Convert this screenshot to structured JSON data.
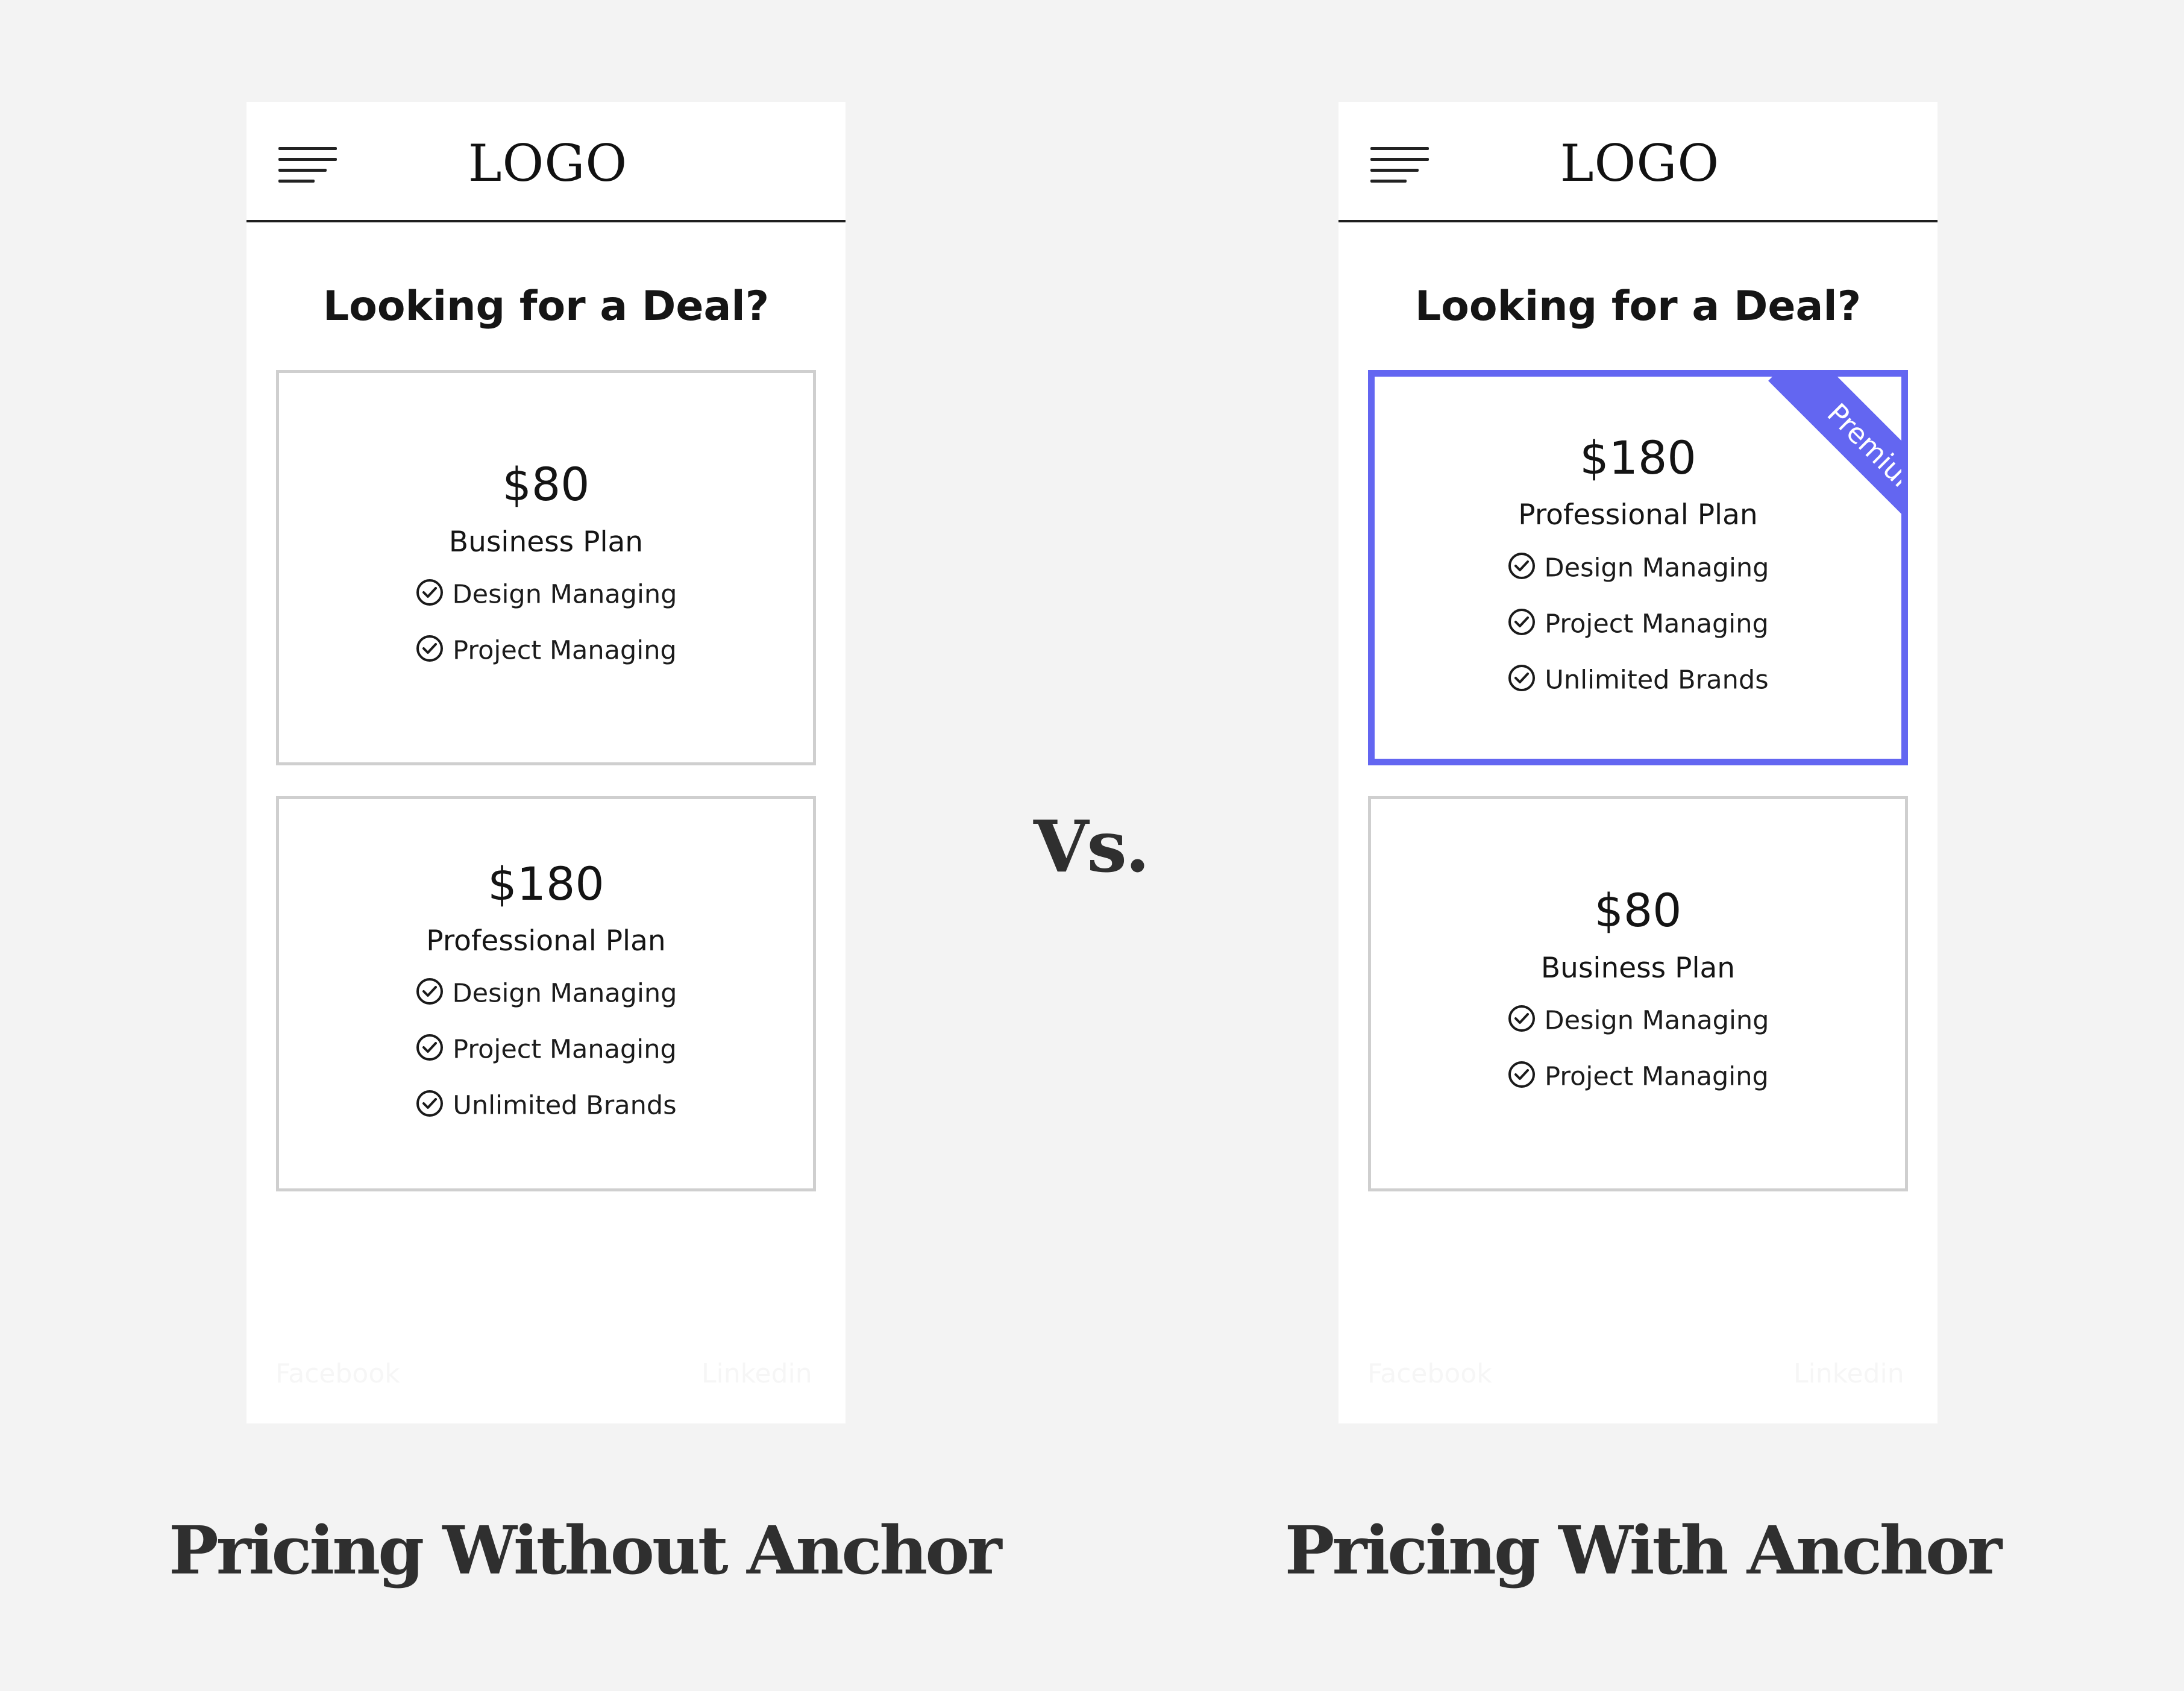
{
  "left_phone": {
    "logo": "LOGO",
    "heading": "Looking for a Deal?",
    "cards": [
      {
        "price": "$80",
        "plan": "Business Plan",
        "features": [
          "Design Managing",
          "Project Managing"
        ]
      },
      {
        "price": "$180",
        "plan": "Professional Plan",
        "features": [
          "Design Managing",
          "Project Managing",
          "Unlimited Brands"
        ]
      }
    ],
    "footer": {
      "facebook": "Facebook",
      "linkedin": "Linkedin"
    }
  },
  "right_phone": {
    "logo": "LOGO",
    "heading": "Looking for a Deal?",
    "cards": [
      {
        "price": "$180",
        "plan": "Professional Plan",
        "badge": "Premium",
        "features": [
          "Design Managing",
          "Project Managing",
          "Unlimited Brands"
        ]
      },
      {
        "price": "$80",
        "plan": "Business Plan",
        "features": [
          "Design Managing",
          "Project Managing"
        ]
      }
    ],
    "footer": {
      "facebook": "Facebook",
      "linkedin": "Linkedin"
    }
  },
  "vs_label": "Vs.",
  "captions": {
    "left": "Pricing Without Anchor",
    "right": "Pricing With Anchor"
  },
  "colors": {
    "accent": "#6366f1",
    "background": "#f3f3f3",
    "card_border": "#cfcfcf"
  },
  "icons": {
    "menu": "hamburger-icon",
    "feature": "check-circle-icon"
  }
}
